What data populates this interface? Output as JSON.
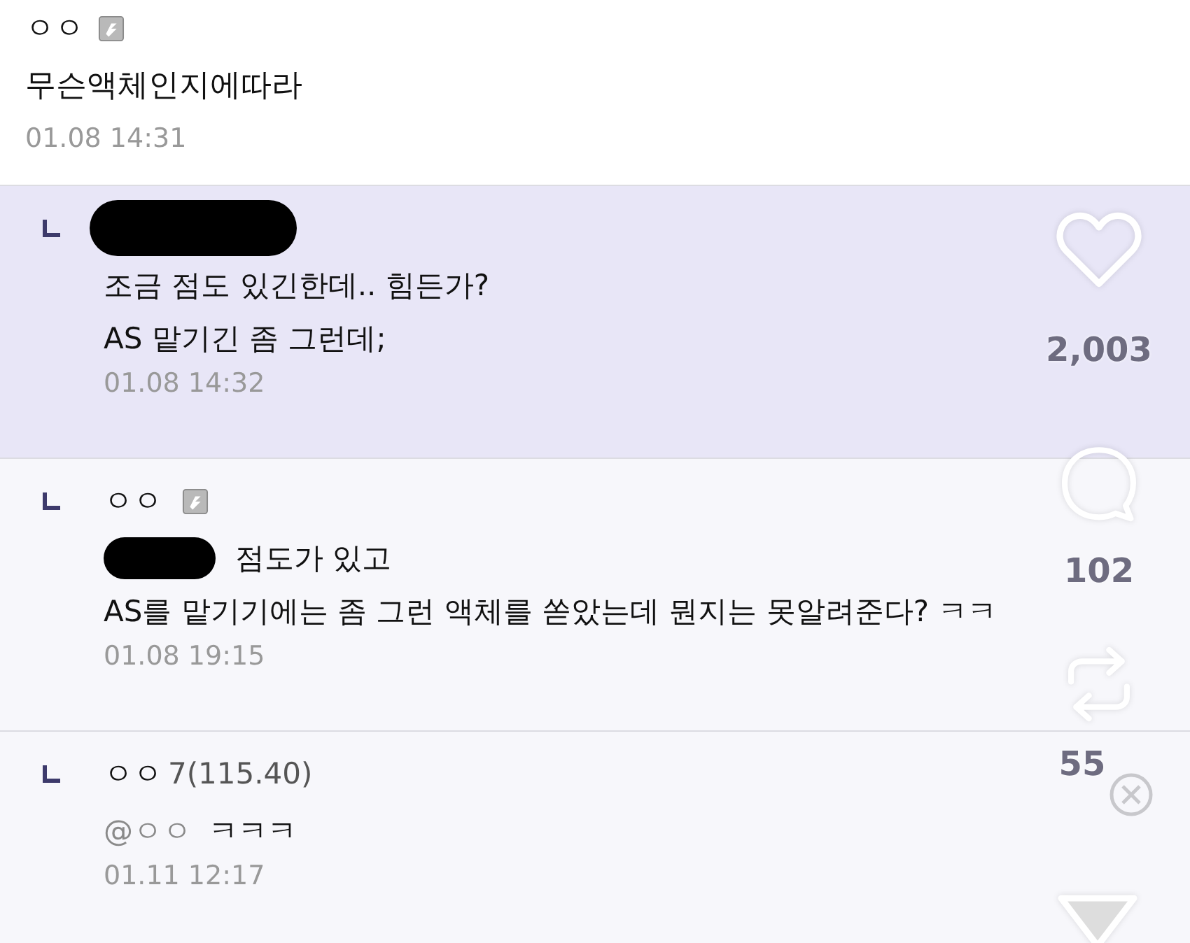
{
  "post": {
    "author": "ㅇㅇ",
    "has_badge": true,
    "text": "무슨액체인지에따라",
    "time": "01.08 14:31"
  },
  "replies": [
    {
      "redacted_author": true,
      "selected": true,
      "lines": [
        "조금 점도 있긴한데.. 힘든가?",
        "AS 맡기긴 좀 그런데;"
      ],
      "time": "01.08 14:32"
    },
    {
      "author": "ㅇㅇ",
      "has_badge": true,
      "selected": false,
      "redacted_prefix": true,
      "lines": [
        "점도가 있고",
        "AS를 맡기기에는 좀 그런 액체를 쏟았는데 뭔지는 못알려준다? ㅋㅋ"
      ],
      "time": "01.08 19:15"
    },
    {
      "author": "ㅇㅇ",
      "author_note": "7(115.40)",
      "selected": false,
      "mention": "@ㅇㅇ",
      "lines": [
        "ㅋㅋㅋ"
      ],
      "time": "01.11 12:17"
    }
  ],
  "actions": [
    {
      "kind": "like",
      "count": "2,003"
    },
    {
      "kind": "comment",
      "count": "102"
    },
    {
      "kind": "repost",
      "count": "55"
    },
    {
      "kind": "close"
    },
    {
      "kind": "share"
    }
  ]
}
